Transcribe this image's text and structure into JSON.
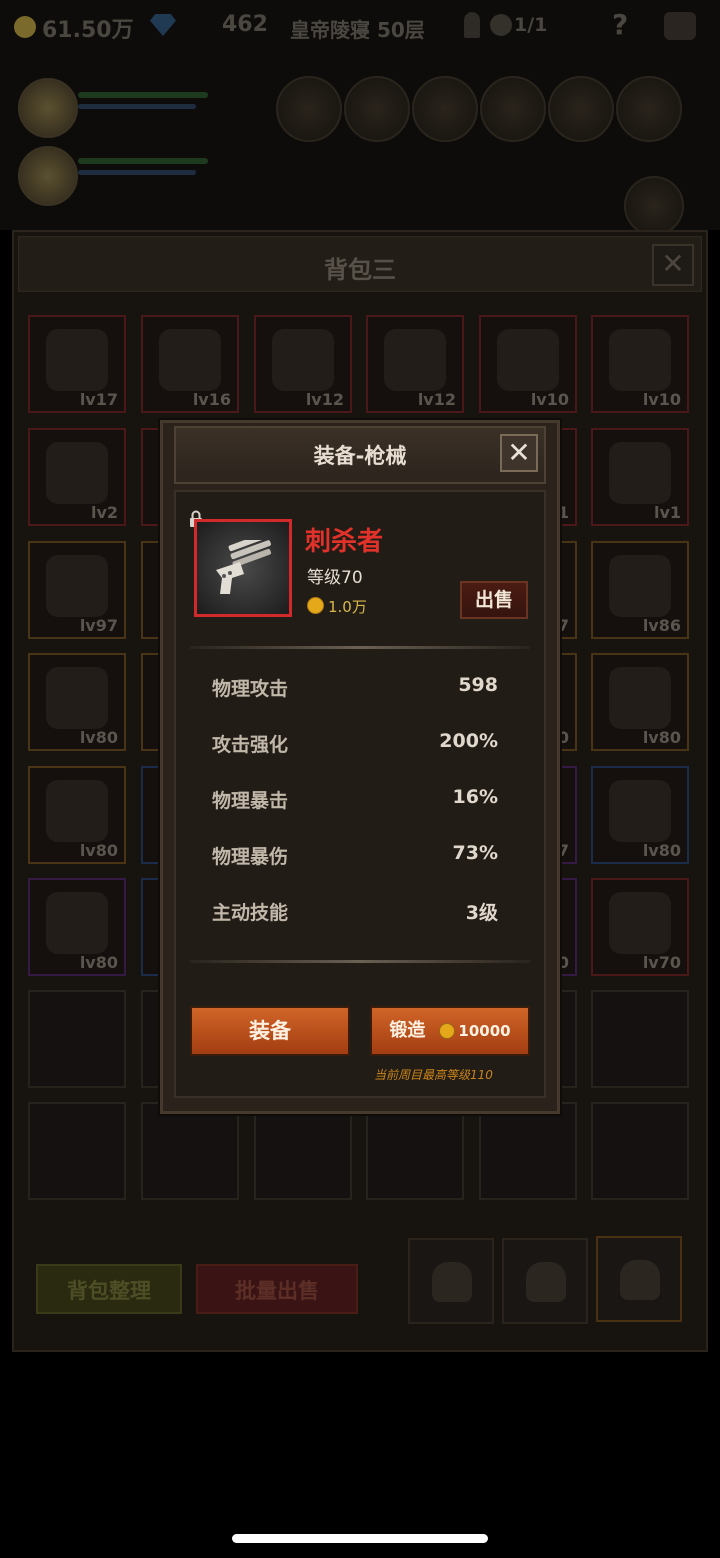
{
  "hud": {
    "gold": "61.50万",
    "gems": "462",
    "tower": "皇帝陵寝 50层",
    "keys": "1/1",
    "help": "?"
  },
  "bag": {
    "title": "背包三",
    "close": "✕",
    "slots": [
      {
        "lv": "lv17",
        "rarity": "r"
      },
      {
        "lv": "lv16",
        "rarity": "r"
      },
      {
        "lv": "lv12",
        "rarity": "r"
      },
      {
        "lv": "lv12",
        "rarity": "r"
      },
      {
        "lv": "lv10",
        "rarity": "r"
      },
      {
        "lv": "lv10",
        "rarity": "r"
      },
      {
        "lv": "lv2",
        "rarity": "r"
      },
      {
        "lv": "",
        "rarity": "r"
      },
      {
        "lv": "",
        "rarity": "r"
      },
      {
        "lv": "",
        "rarity": "r"
      },
      {
        "lv": "1",
        "rarity": "r"
      },
      {
        "lv": "lv1",
        "rarity": "r"
      },
      {
        "lv": "lv97",
        "rarity": "o"
      },
      {
        "lv": "",
        "rarity": "o"
      },
      {
        "lv": "",
        "rarity": "o"
      },
      {
        "lv": "",
        "rarity": "o"
      },
      {
        "lv": "7",
        "rarity": "o"
      },
      {
        "lv": "lv86",
        "rarity": "o"
      },
      {
        "lv": "lv80",
        "rarity": "o"
      },
      {
        "lv": "",
        "rarity": "o"
      },
      {
        "lv": "",
        "rarity": "o"
      },
      {
        "lv": "",
        "rarity": "o"
      },
      {
        "lv": "0",
        "rarity": "o"
      },
      {
        "lv": "lv80",
        "rarity": "o"
      },
      {
        "lv": "lv80",
        "rarity": "o"
      },
      {
        "lv": "",
        "rarity": "b"
      },
      {
        "lv": "",
        "rarity": "b"
      },
      {
        "lv": "",
        "rarity": "b"
      },
      {
        "lv": "7",
        "rarity": "p"
      },
      {
        "lv": "lv80",
        "rarity": "b"
      },
      {
        "lv": "lv80",
        "rarity": "p"
      },
      {
        "lv": "",
        "rarity": "b"
      },
      {
        "lv": "",
        "rarity": "b"
      },
      {
        "lv": "",
        "rarity": "b"
      },
      {
        "lv": "0",
        "rarity": "p"
      },
      {
        "lv": "lv70",
        "rarity": "r"
      },
      {
        "lv": "",
        "rarity": "e"
      },
      {
        "lv": "",
        "rarity": "e"
      },
      {
        "lv": "",
        "rarity": "e"
      },
      {
        "lv": "",
        "rarity": "e"
      },
      {
        "lv": "",
        "rarity": "e"
      },
      {
        "lv": "",
        "rarity": "e"
      },
      {
        "lv": "",
        "rarity": "e"
      },
      {
        "lv": "",
        "rarity": "e"
      },
      {
        "lv": "",
        "rarity": "e"
      },
      {
        "lv": "",
        "rarity": "e"
      },
      {
        "lv": "",
        "rarity": "e"
      },
      {
        "lv": "",
        "rarity": "e"
      }
    ],
    "sort_label": "背包整理",
    "bulk_sell_label": "批量出售"
  },
  "modal": {
    "title": "装备-枪械",
    "close": "✕",
    "item": {
      "name": "刺杀者",
      "level": "等级70",
      "price": "1.0万",
      "name_color": "#e0322a"
    },
    "sell_label": "出售",
    "stats": [
      {
        "name": "物理攻击",
        "value": "598"
      },
      {
        "name": "攻击强化",
        "value": "200%"
      },
      {
        "name": "物理暴击",
        "value": "16%"
      },
      {
        "name": "物理暴伤",
        "value": "73%"
      },
      {
        "name": "主动技能",
        "value": "3级"
      }
    ],
    "equip_label": "装备",
    "forge_label": "锻造",
    "forge_cost": "10000",
    "max_level_note": "当前周目最高等级110"
  }
}
